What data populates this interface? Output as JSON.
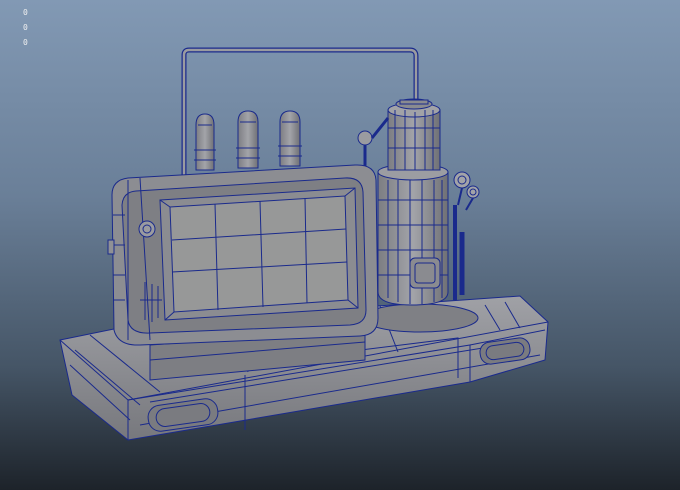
{
  "viewport": {
    "hud_lines": [
      "0",
      "0",
      "0"
    ],
    "background_top": "#8299b4",
    "background_bottom": "#1d232a"
  },
  "model": {
    "surface_color": "#8f8f93",
    "surface_dark": "#6e6f74",
    "wireframe_color": "#1a2a8c",
    "icon": "steampunk-machine-wireframe-icon"
  }
}
